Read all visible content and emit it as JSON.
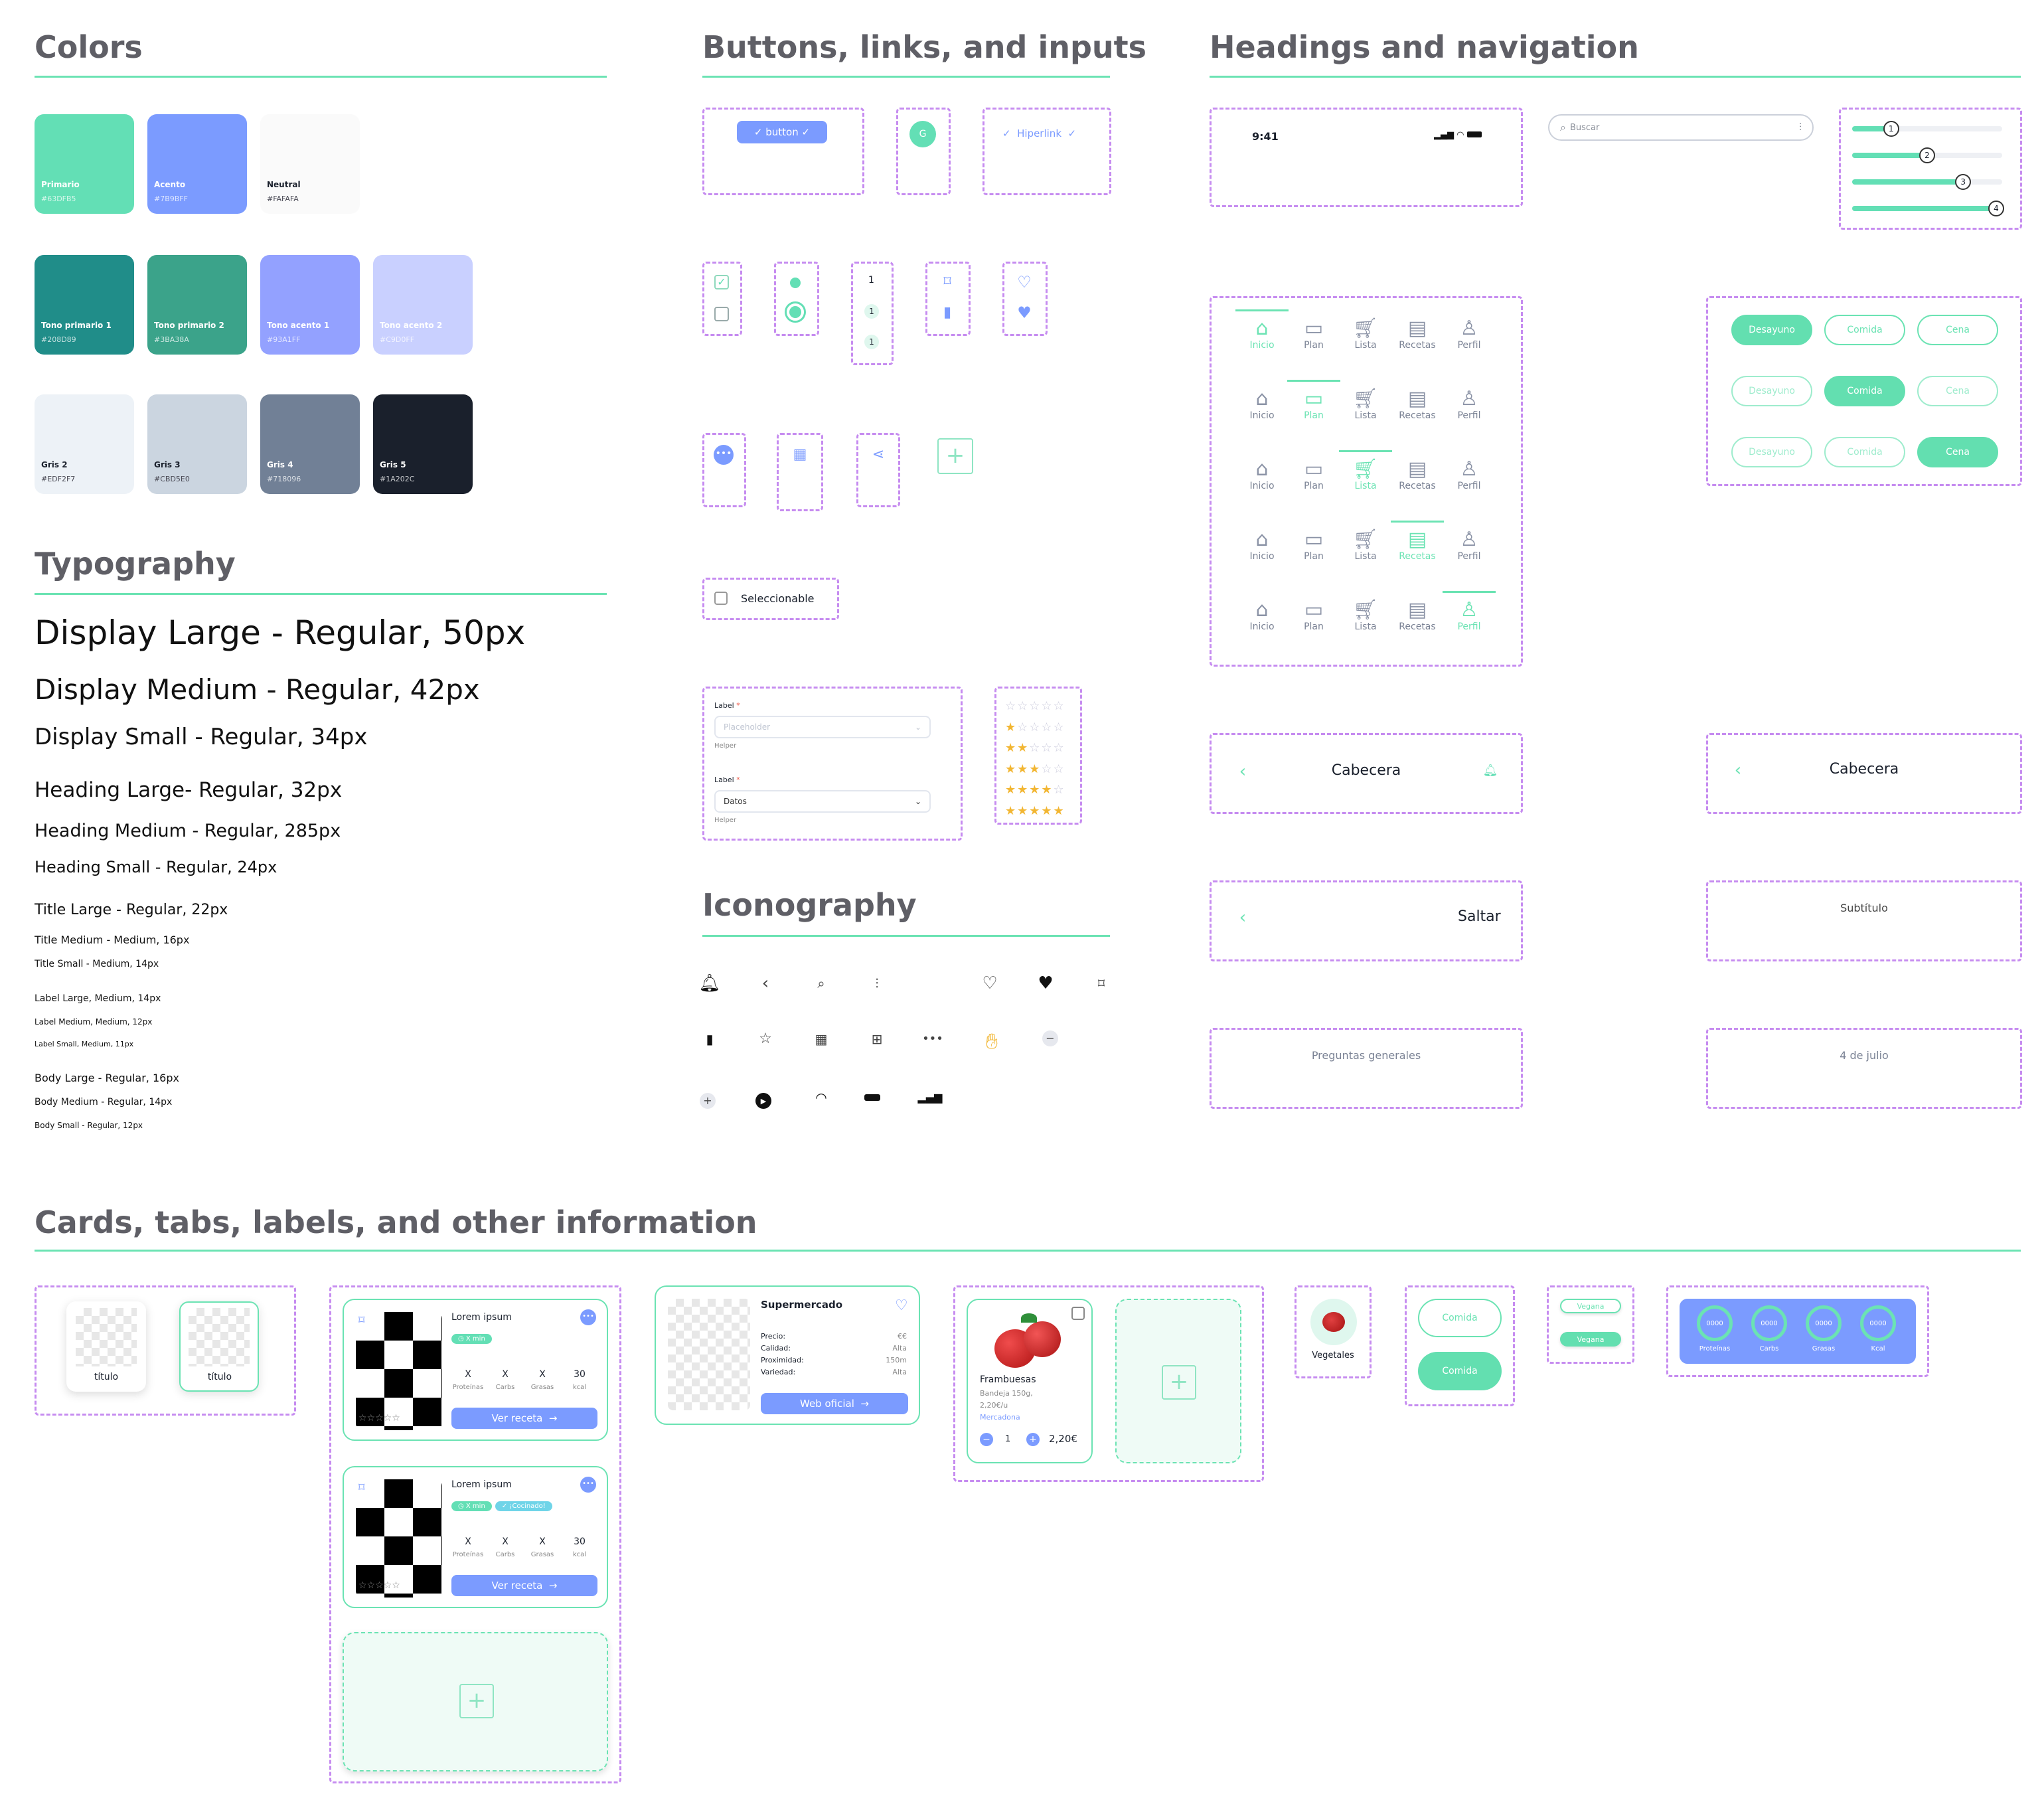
{
  "sections": {
    "colors": "Colors",
    "buttons": "Buttons, links, and inputs",
    "headings": "Headings and navigation",
    "typography": "Typography",
    "iconography": "Iconography",
    "cards": "Cards, tabs, labels, and other information"
  },
  "swatches": [
    {
      "name": "Primario",
      "hex": "#63DFB5",
      "color": "#63DFB5"
    },
    {
      "name": "Acento",
      "hex": "#7B9BFF",
      "color": "#7B9BFF"
    },
    {
      "name": "Neutral",
      "hex": "#FAFAFA",
      "color": "#FAFAFA"
    },
    {
      "name": "Tono primario 1",
      "hex": "#208D89",
      "color": "#208D89"
    },
    {
      "name": "Tono primario 2",
      "hex": "#3BA38A",
      "color": "#3BA38A"
    },
    {
      "name": "Tono acento 1",
      "hex": "#93A1FF",
      "color": "#93A1FF"
    },
    {
      "name": "Tono acento 2",
      "hex": "#C9D0FF",
      "color": "#C9D0FF"
    },
    {
      "name": "Gris 2",
      "hex": "#EDF2F7",
      "color": "#EDF2F7"
    },
    {
      "name": "Gris 3",
      "hex": "#CBD5E0",
      "color": "#CBD5E0"
    },
    {
      "name": "Gris 4",
      "hex": "#718096",
      "color": "#718096"
    },
    {
      "name": "Gris 5",
      "hex": "#1A202C",
      "color": "#1A202C"
    }
  ],
  "typography": [
    "Display Large - Regular, 50px",
    "Display Medium - Regular, 42px",
    "Display Small - Regular, 34px",
    "Heading Large- Regular, 32px",
    "Heading Medium - Regular, 285px",
    "Heading Small - Regular, 24px",
    "Title Large - Regular, 22px",
    "Title Medium - Medium, 16px",
    "Title Small - Medium, 14px",
    "Label Large, Medium, 14px",
    "Label Medium, Medium, 12px",
    "Label Small, Medium, 11px",
    "Body Large - Regular, 16px",
    "Body Medium - Regular, 14px",
    "Body Small - Regular, 12px"
  ],
  "buttons": {
    "button": "button",
    "avatar": "G",
    "link": "Hiperlink",
    "stepper": [
      "1",
      "1",
      "1"
    ],
    "selectable": "Seleccionable",
    "field1_label": "Label",
    "field1_placeholder": "Placeholder",
    "field1_helper": "Helper",
    "field2_label": "Label",
    "field2_value": "Datos",
    "field2_helper": "Helper",
    "required": "*"
  },
  "status": {
    "time": "9:41"
  },
  "search": {
    "placeholder": "Buscar"
  },
  "sliders": [
    "1",
    "2",
    "3",
    "4"
  ],
  "nav": [
    "Inicio",
    "Plan",
    "Lista",
    "Recetas",
    "Perfil"
  ],
  "meals": [
    "Desayuno",
    "Comida",
    "Cena"
  ],
  "headers": {
    "h1": "Cabecera",
    "h2": "Cabecera",
    "skip": "Saltar",
    "subtitle": "Subtítulo",
    "faq": "Preguntas generales",
    "date": "4 de julio"
  },
  "cards": {
    "title_card": "título",
    "recipe": {
      "name": "Lorem ipsum",
      "time": "X min",
      "cooking": "¡Cocinado!",
      "macro_vals": [
        "X",
        "X",
        "X",
        "30"
      ],
      "macro_labels": [
        "Proteínas",
        "Carbs",
        "Grasas",
        "kcal"
      ],
      "cta": "Ver receta"
    },
    "market": {
      "name": "Supermercado",
      "rows": [
        [
          "Precio:",
          "€€"
        ],
        [
          "Calidad:",
          "Alta"
        ],
        [
          "Proximidad:",
          "150m"
        ],
        [
          "Variedad:",
          "Alta"
        ]
      ],
      "cta": "Web oficial"
    },
    "product": {
      "name": "Frambuesas",
      "desc": "Bandeja 150g,",
      "unit": "2,20€/u",
      "store": "Mercadona",
      "qty": "1",
      "price": "2,20€"
    },
    "category": "Vegetales",
    "tag_comida": "Comida",
    "tag_vegana": "Vegana",
    "macros": {
      "value": "0000",
      "labels": [
        "Proteínas",
        "Carbs",
        "Grasas",
        "Kcal"
      ]
    }
  }
}
